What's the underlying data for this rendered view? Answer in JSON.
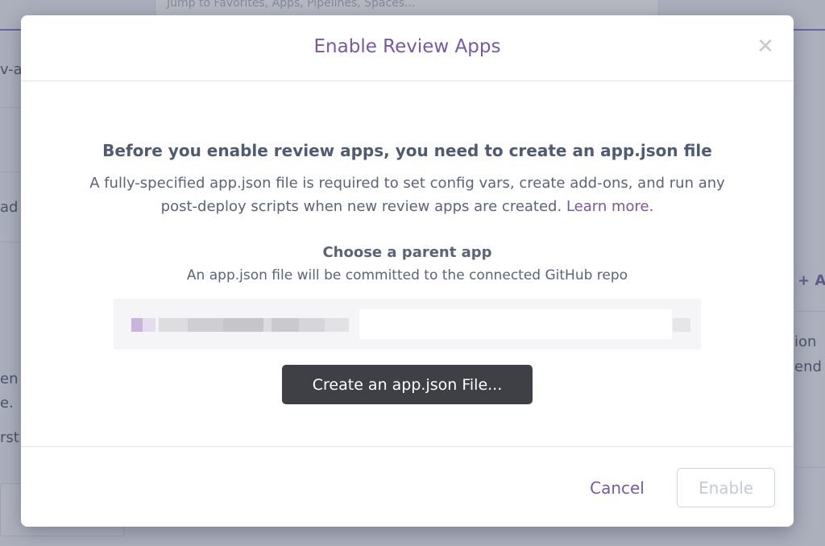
{
  "background": {
    "search_placeholder": "Jump to Favorites, Apps, Pipelines, Spaces...",
    "frag_w": "v-a",
    "frag_ad": "ad",
    "frag_en": "en",
    "frag_e": "e.",
    "frag_rst": "rst",
    "frag_add": "+ A",
    "frag_ion": "ion",
    "frag_end": "end"
  },
  "modal": {
    "title": "Enable Review Apps",
    "close_glyph": "✕",
    "heading": "Before you enable review apps, you need to create an app.json file",
    "description": "A fully-specified app.json file is required to set config vars, create add-ons, and run any post-deploy scripts when new review apps are created.",
    "learn_more": "Learn more",
    "description_end": ".",
    "parent_title": "Choose a parent app",
    "parent_subtitle": "An app.json file will be committed to the connected GitHub repo",
    "create_button": "Create an app.json File...",
    "cancel_button": "Cancel",
    "enable_button": "Enable"
  },
  "colors": {
    "accent": "#79589f",
    "dark_button": "#3f4045",
    "text": "#5a6379"
  }
}
